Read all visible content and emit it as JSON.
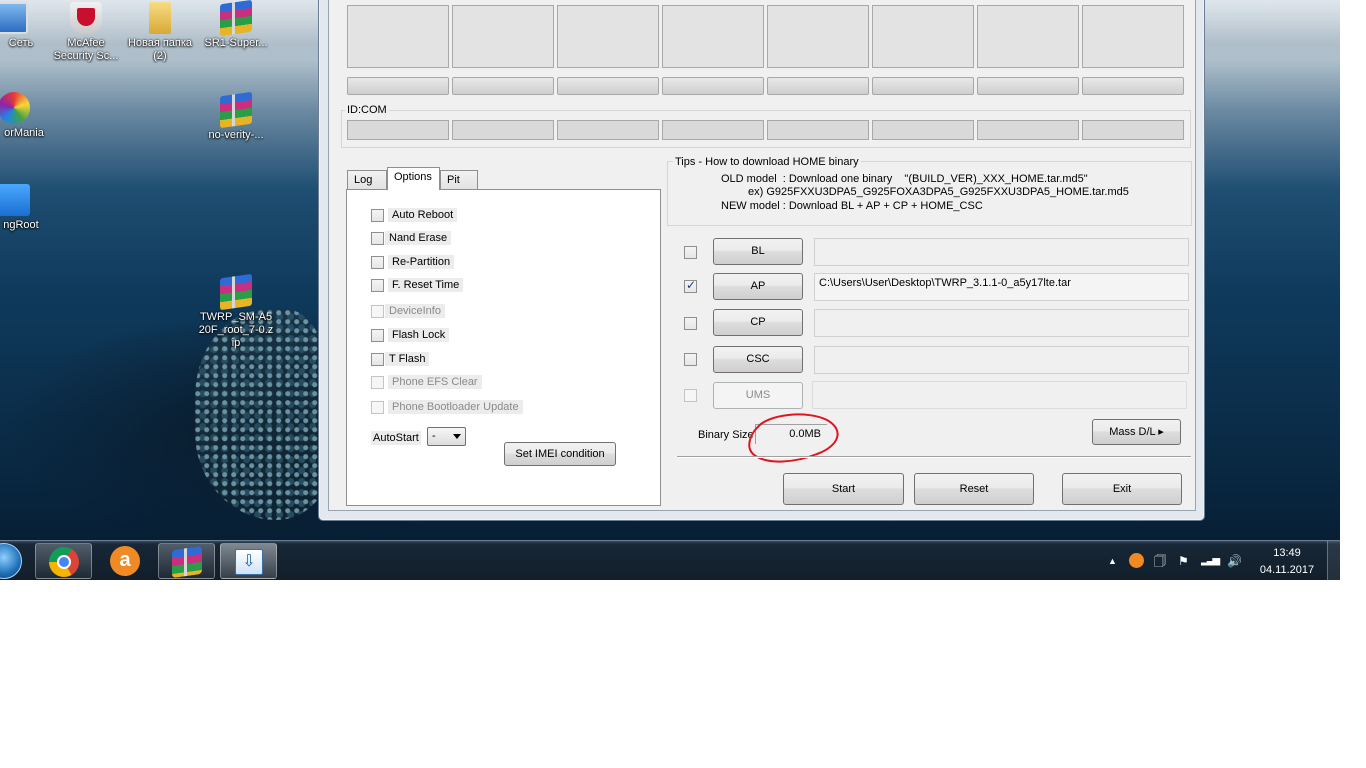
{
  "desktop": {
    "icons": [
      {
        "label": "Сеть",
        "glyph_color": "#3a7bd5"
      },
      {
        "label": "McAfee Security Sc...",
        "glyph_color": "#c8102e"
      },
      {
        "label": "Новая папка (2)",
        "glyph_color": "#e8c04a"
      },
      {
        "label": "SR1-Super...",
        "glyph_color": "#2e6bd6"
      },
      {
        "label": "orMania",
        "glyph_color": "#e54a3a"
      },
      {
        "label": "no-verity-...",
        "glyph_color": "#2e6bd6"
      },
      {
        "label": "ngRoot",
        "glyph_color": "#2a88d8"
      },
      {
        "label": "TWRP_SM-A520F_root_7-0.zip",
        "glyph_color": "#2e6bd6"
      }
    ]
  },
  "odin": {
    "id_com_label": "ID:COM",
    "tabs": [
      {
        "label": "Log"
      },
      {
        "label": "Options"
      },
      {
        "label": "Pit"
      }
    ],
    "options": [
      {
        "label": "Auto Reboot",
        "checked": false,
        "enabled": true
      },
      {
        "label": "Nand Erase",
        "checked": false,
        "enabled": true
      },
      {
        "label": "Re-Partition",
        "checked": false,
        "enabled": true
      },
      {
        "label": "F. Reset Time",
        "checked": false,
        "enabled": true
      },
      {
        "label": "DeviceInfo",
        "checked": false,
        "enabled": false
      },
      {
        "label": "Flash Lock",
        "checked": false,
        "enabled": true
      },
      {
        "label": "T Flash",
        "checked": false,
        "enabled": true
      },
      {
        "label": "Phone EFS Clear",
        "checked": false,
        "enabled": false
      },
      {
        "label": "Phone Bootloader Update",
        "checked": false,
        "enabled": false
      }
    ],
    "autostart_label": "AutoStart",
    "autostart_value": "-",
    "set_imei_label": "Set IMEI condition",
    "tips": {
      "title": "Tips - How to download HOME binary",
      "line1": "OLD model  : Download one binary    \"(BUILD_VER)_XXX_HOME.tar.md5\"",
      "line2": "ex) G925FXXU3DPA5_G925FOXA3DPA5_G925FXXU3DPA5_HOME.tar.md5",
      "line3": "NEW model : Download BL + AP + CP + HOME_CSC"
    },
    "files": [
      {
        "button": "BL",
        "checked": false,
        "enabled": true,
        "path": ""
      },
      {
        "button": "AP",
        "checked": true,
        "enabled": true,
        "path": "C:\\Users\\User\\Desktop\\TWRP_3.1.1-0_a5y17lte.tar"
      },
      {
        "button": "CP",
        "checked": false,
        "enabled": true,
        "path": ""
      },
      {
        "button": "CSC",
        "checked": false,
        "enabled": true,
        "path": ""
      },
      {
        "button": "UMS",
        "checked": false,
        "enabled": false,
        "path": ""
      }
    ],
    "binary_size_label": "Binary Size",
    "binary_size_value": "0.0MB",
    "mass_dl_label": "Mass D/L ▸",
    "start_label": "Start",
    "reset_label": "Reset",
    "exit_label": "Exit",
    "annotation_color": "#e0141e"
  },
  "taskbar": {
    "start_orb": "start-orb",
    "pinned": [
      "chrome-icon",
      "avast-icon",
      "winrar-icon",
      "odin-download-icon"
    ],
    "clock_time": "13:49",
    "clock_date": "04.11.2017"
  }
}
